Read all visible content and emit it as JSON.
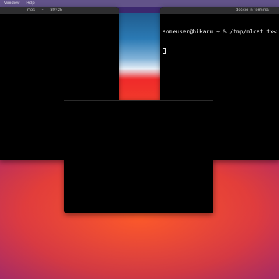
{
  "menubar": {
    "items": [
      "Window",
      "Help"
    ]
  },
  "windows": {
    "left": {
      "title": "mps — ~ — 80×25"
    },
    "right": {
      "title": "docker-in-terminal",
      "lines": [
        "someuser@hikaru ~ % /tmp/mlcat tx< mo",
        ""
      ]
    },
    "center": {
      "title": ""
    }
  },
  "colors": {
    "terminal_bg": "#000000",
    "terminal_text": "#e9e9e9",
    "titlebar": "#2d2d2f"
  }
}
